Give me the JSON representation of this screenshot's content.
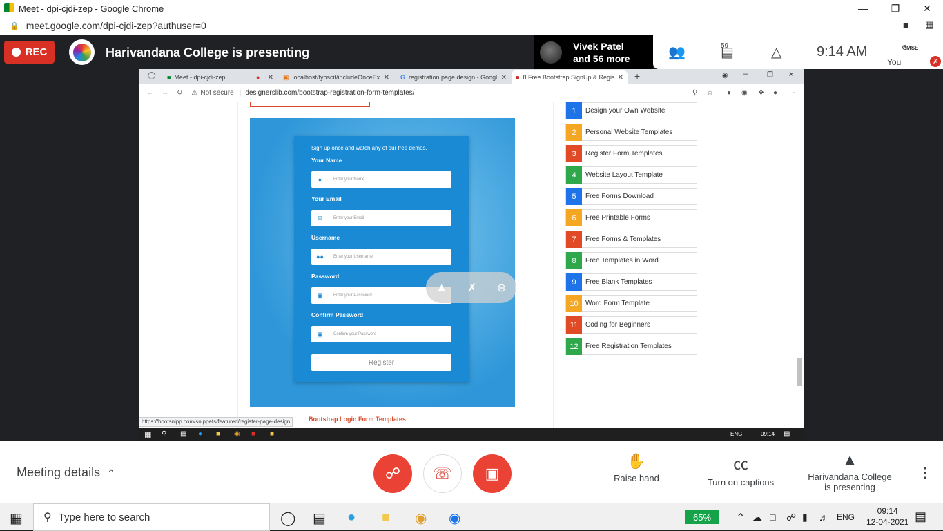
{
  "chrome": {
    "title": "Meet - dpi-cjdi-zep - Google Chrome",
    "url": "meet.google.com/dpi-cjdi-zep?authuser=0"
  },
  "meet": {
    "rec_label": "REC",
    "presenting_title": "Harivandana College is presenting",
    "participant_name": "Vivek Patel",
    "participant_more": "and 56 more",
    "people_count": "59",
    "time": "9:14 AM",
    "you_label": "You",
    "you_tile_text": "ઉMSE",
    "meeting_details": "Meeting details",
    "raise_hand": "Raise hand",
    "captions": "Turn on captions",
    "presenting_line1": "Harivandana College",
    "presenting_line2": "is presenting"
  },
  "shared": {
    "tabs": [
      {
        "label": "Meet - dpi-cjdi-zep"
      },
      {
        "label": "localhost/fybscit/includeOnceEx"
      },
      {
        "label": "registration page design - Googl"
      },
      {
        "label": "8 Free Bootstrap SignUp & Regis"
      }
    ],
    "not_secure": "Not secure",
    "url": "designerslib.com/bootstrap-registration-form-templates/",
    "form": {
      "tagline": "Sign up once and watch any of our free demos.",
      "fields": [
        {
          "label": "Your Name",
          "placeholder": "Enter your Name",
          "icon": "user-icon"
        },
        {
          "label": "Your Email",
          "placeholder": "Enter your Email",
          "icon": "envelope-icon"
        },
        {
          "label": "Username",
          "placeholder": "Enter your Username",
          "icon": "users-icon"
        },
        {
          "label": "Password",
          "placeholder": "Enter your Password",
          "icon": "lock-icon"
        },
        {
          "label": "Confirm Password",
          "placeholder": "Confirm your Password",
          "icon": "lock-icon"
        }
      ],
      "register": "Register"
    },
    "link_red": "Bootstrap Login Form Templates",
    "status_url": "https://bootsnipp.com/snippets/featured/register-page-design",
    "side_list": [
      {
        "n": "1",
        "label": "Design your Own Website",
        "color": "#1e73e8"
      },
      {
        "n": "2",
        "label": "Personal Website Templates",
        "color": "#f5a623"
      },
      {
        "n": "3",
        "label": "Register Form Templates",
        "color": "#e04a25"
      },
      {
        "n": "4",
        "label": "Website Layout Template",
        "color": "#2ea84a"
      },
      {
        "n": "5",
        "label": "Free Forms Download",
        "color": "#1e73e8"
      },
      {
        "n": "6",
        "label": "Free Printable Forms",
        "color": "#f5a623"
      },
      {
        "n": "7",
        "label": "Free Forms & Templates",
        "color": "#e04a25"
      },
      {
        "n": "8",
        "label": "Free Templates in Word",
        "color": "#2ea84a"
      },
      {
        "n": "9",
        "label": "Free Blank Templates",
        "color": "#1e73e8"
      },
      {
        "n": "10",
        "label": "Word Form Template",
        "color": "#f5a623"
      },
      {
        "n": "11",
        "label": "Coding for Beginners",
        "color": "#e04a25"
      },
      {
        "n": "12",
        "label": "Free Registration Templates",
        "color": "#2ea84a"
      }
    ],
    "inner_tray": {
      "lang": "ENG",
      "time": "09:14"
    }
  },
  "taskbar": {
    "search_placeholder": "Type here to search",
    "battery": "65%",
    "lang": "ENG",
    "time": "09:14",
    "date": "12-04-2021"
  }
}
